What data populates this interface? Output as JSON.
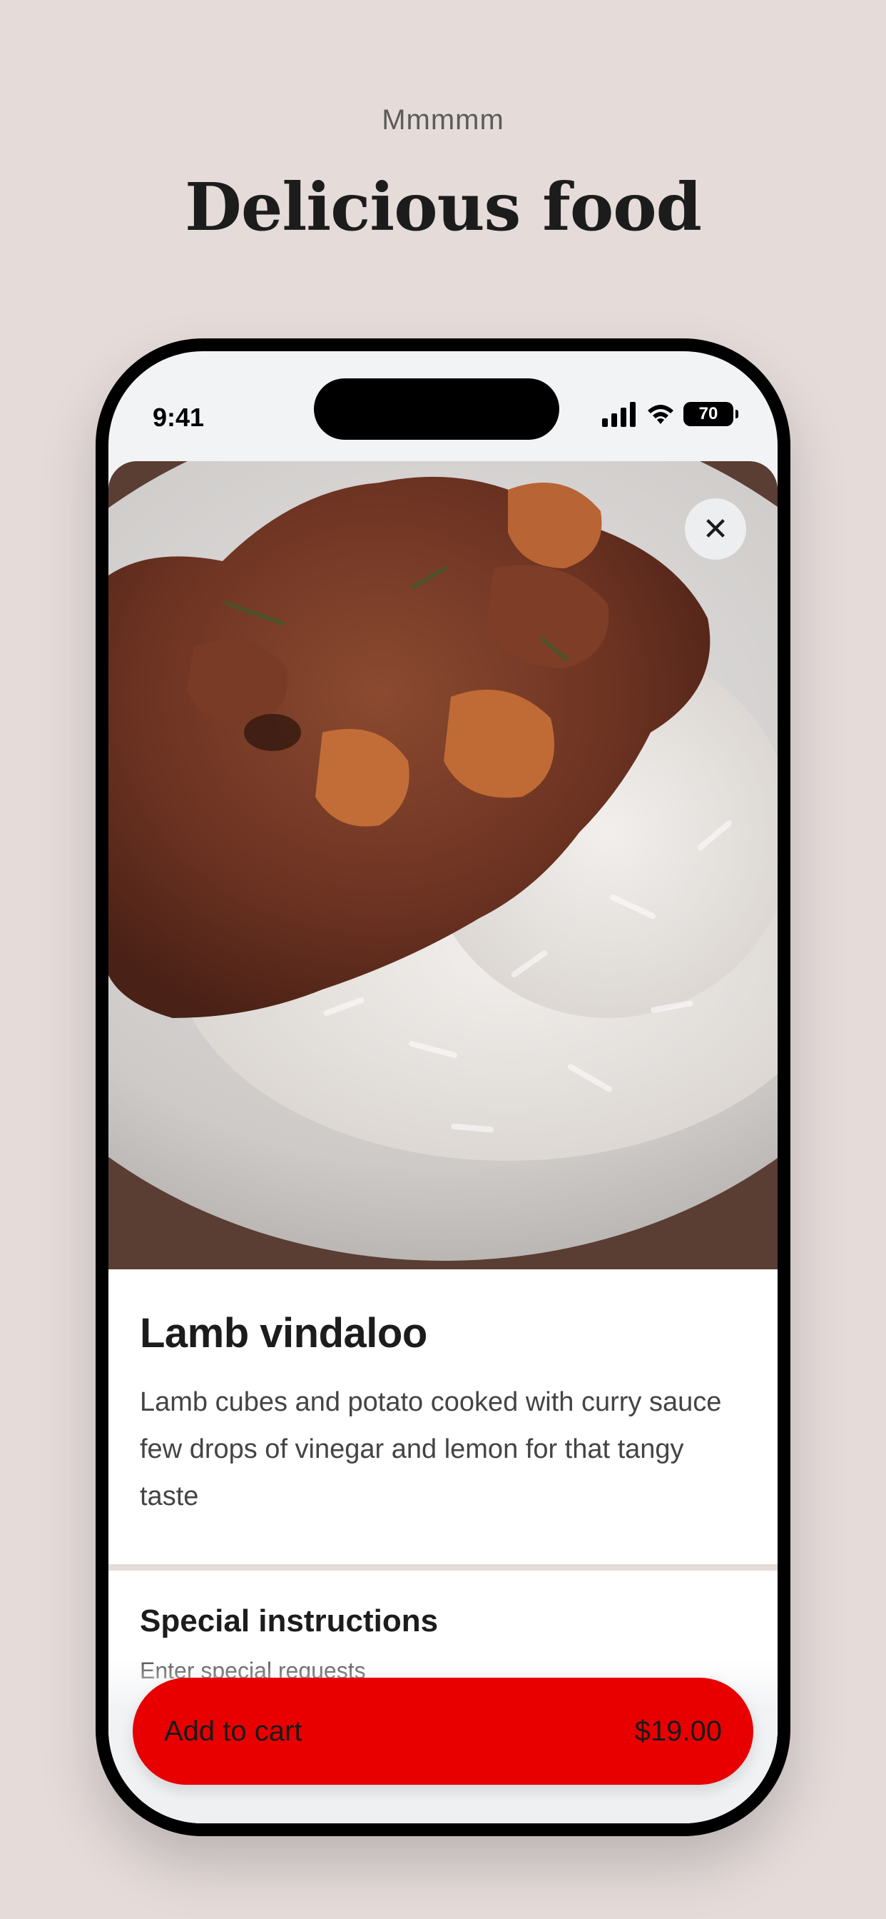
{
  "header": {
    "eyebrow": "Mmmmm",
    "headline": "Delicious food"
  },
  "status_bar": {
    "time": "9:41",
    "battery": "70",
    "icons": [
      "signal-icon",
      "wifi-icon",
      "battery-icon"
    ]
  },
  "item": {
    "close_icon": "✕",
    "title": "Lamb vindaloo",
    "description": "Lamb cubes and potato cooked with curry sauce few drops of vinegar and lemon for that tangy taste"
  },
  "instructions": {
    "title": "Special instructions",
    "placeholder": "Enter special requests"
  },
  "cart": {
    "label": "Add to cart",
    "price": "$19.00"
  },
  "colors": {
    "background": "#e5dcda",
    "accent": "#e80000",
    "text": "#1c1c1c"
  }
}
